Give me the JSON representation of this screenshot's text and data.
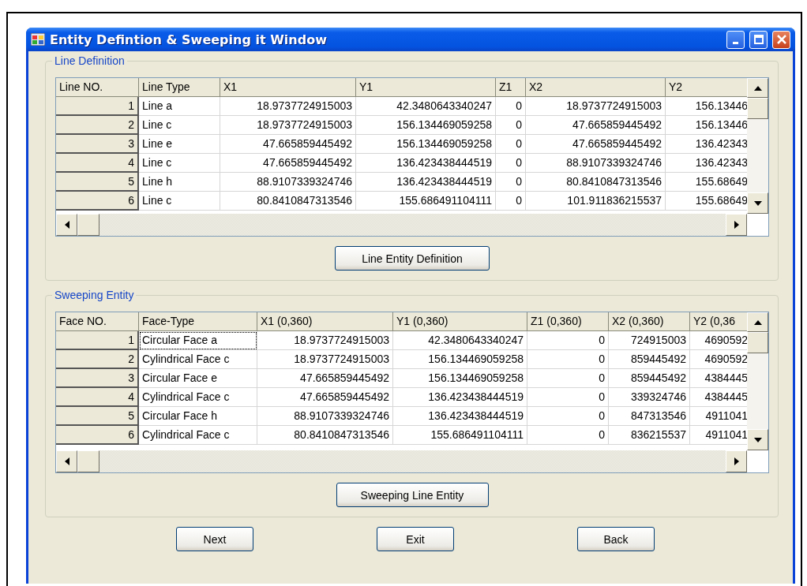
{
  "window": {
    "title": "Entity Defintion & Sweeping it  Window"
  },
  "line_definition": {
    "title": "Line Definition",
    "columns": [
      "Line NO.",
      "Line Type",
      "X1",
      "Y1",
      "Z1",
      "X2",
      "Y2"
    ],
    "rows": [
      {
        "focused": false,
        "cells": [
          "1",
          "Line a",
          "18.9737724915003",
          "42.3480643340247",
          "0",
          "18.9737724915003",
          "156.13446"
        ]
      },
      {
        "focused": false,
        "cells": [
          "2",
          "Line c",
          "18.9737724915003",
          "156.134469059258",
          "0",
          "47.665859445492",
          "156.13446"
        ]
      },
      {
        "focused": false,
        "cells": [
          "3",
          "Line e",
          "47.665859445492",
          "156.134469059258",
          "0",
          "47.665859445492",
          "136.42343"
        ]
      },
      {
        "focused": false,
        "cells": [
          "4",
          "Line c",
          "47.665859445492",
          "136.423438444519",
          "0",
          "88.9107339324746",
          "136.42343"
        ]
      },
      {
        "focused": false,
        "cells": [
          "5",
          "Line h",
          "88.9107339324746",
          "136.423438444519",
          "0",
          "80.8410847313546",
          "155.68649"
        ]
      },
      {
        "focused": false,
        "cells": [
          "6",
          "Line c",
          "80.8410847313546",
          "155.686491104111",
          "0",
          "101.911836215537",
          "155.68649"
        ]
      }
    ],
    "button": "Line Entity Definition"
  },
  "sweeping_entity": {
    "title": "Sweeping Entity",
    "columns": [
      "Face NO.",
      "Face-Type",
      "X1 (0,360)",
      "Y1 (0,360)",
      "Z1 (0,360)",
      "X2 (0,360)",
      "Y2 (0,36"
    ],
    "rows": [
      {
        "focused": true,
        "cells": [
          "1",
          "Circular Face a",
          "18.9737724915003",
          "42.3480643340247",
          "0",
          "724915003",
          "4690592"
        ]
      },
      {
        "focused": false,
        "cells": [
          "2",
          "Cylindrical Face c",
          "18.9737724915003",
          "156.134469059258",
          "0",
          "859445492",
          "4690592"
        ]
      },
      {
        "focused": false,
        "cells": [
          "3",
          "Circular Face e",
          "47.665859445492",
          "156.134469059258",
          "0",
          "859445492",
          "4384445"
        ]
      },
      {
        "focused": false,
        "cells": [
          "4",
          "Cylindrical Face c",
          "47.665859445492",
          "136.423438444519",
          "0",
          "339324746",
          "4384445"
        ]
      },
      {
        "focused": false,
        "cells": [
          "5",
          "Circular Face h",
          "88.9107339324746",
          "136.423438444519",
          "0",
          "847313546",
          "4911041"
        ]
      },
      {
        "focused": false,
        "cells": [
          "6",
          "Cylindrical Face c",
          "80.8410847313546",
          "155.686491104111",
          "0",
          "836215537",
          "4911041"
        ]
      }
    ],
    "button": "Sweeping Line Entity"
  },
  "buttons": [
    "Next",
    "Exit",
    "Back"
  ]
}
